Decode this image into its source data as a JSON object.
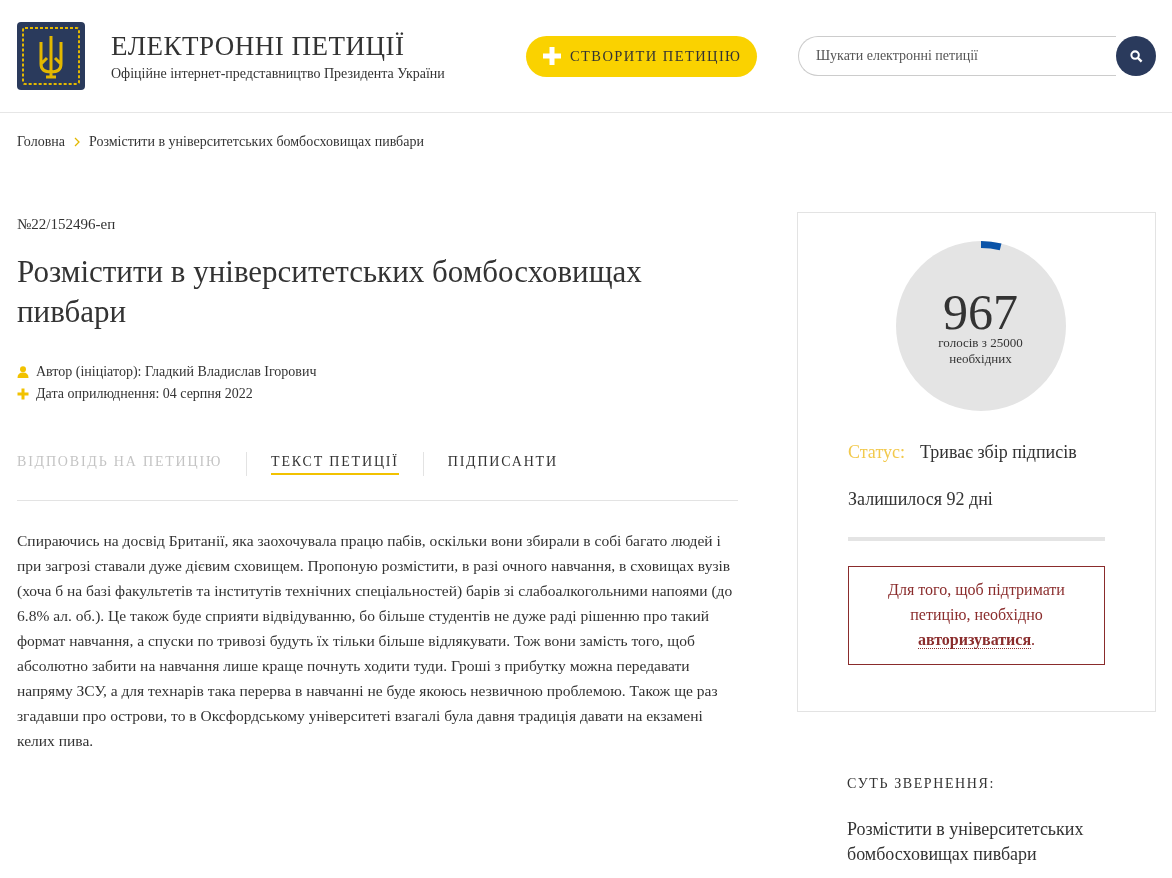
{
  "header": {
    "title": "ЕЛЕКТРОННІ ПЕТИЦІЇ",
    "subtitle": "Офіційне інтернет-представництво Президента України",
    "create_button": "СТВОРИТИ ПЕТИЦІЮ",
    "search": {
      "placeholder": "Шукати електронні петиції"
    }
  },
  "breadcrumbs": [
    "Головна",
    "Розмістити в університетських бомбосховищах пивбари"
  ],
  "petition": {
    "number": "№22/152496-еп",
    "title": "Розмістити в університетських бомбосховищах пивбари",
    "meta": [
      {
        "kind": "author",
        "text": "Автор (ініціатор): Гладкий Владислав Ігорович"
      },
      {
        "kind": "date",
        "text": "Дата оприлюднення: 04 серпня 2022"
      }
    ],
    "tabs": [
      {
        "label": "ВІДПОВІДЬ НА ПЕТИЦІЮ",
        "selected": false,
        "disabled": true
      },
      {
        "label": "ТЕКСТ ПЕТИЦІЇ",
        "selected": true,
        "disabled": false
      },
      {
        "label": "ПІДПИСАНТИ",
        "selected": false,
        "disabled": false
      }
    ],
    "body": "Спираючись на досвід Британії, яка заохочувала працю пабів, оскільки вони збирали в собі багато людей і при загрозі ставали дуже дієвим сховищем. Пропоную розмістити, в разі очного навчання, в сховищах вузів (хоча б на базі факультетів та інститутів технічних спеціальностей) барів зі слабоалкогольними напоями (до 6.8% ал. об.). Це також буде сприяти відвідуванню, бо більше студентів не дуже раді рішенню про такий формат навчання, а спуски по тривозі будуть їх тільки більше відлякувати. Тож вони замість того, щоб абсолютно забити на навчання лише краще почнуть ходити туди. Гроші з прибутку можна передавати напряму ЗСУ, а для технарів така перерва в навчанні не буде якоюсь незвичною проблемою. Також ще раз згадавши про острови, то в Оксфордському університеті взагалі була давня традиція давати на екзамені келих пива."
  },
  "sidebar": {
    "votes": {
      "count": "967",
      "caption_1": "голосів з 25000",
      "caption_2": "необхідних"
    },
    "status_label": "Статус:",
    "status": "Триває збір підписів",
    "remaining": "Залишилося 92 дні",
    "auth_notice": {
      "text_before": "Для того, щоб підтримати петицію, необхідно ",
      "link": "авторизуватися",
      "text_after": "."
    },
    "summary_heading": "СУТЬ ЗВЕРНЕННЯ:",
    "summary": "Розмістити в університетських бомбосховищах пивбари"
  }
}
